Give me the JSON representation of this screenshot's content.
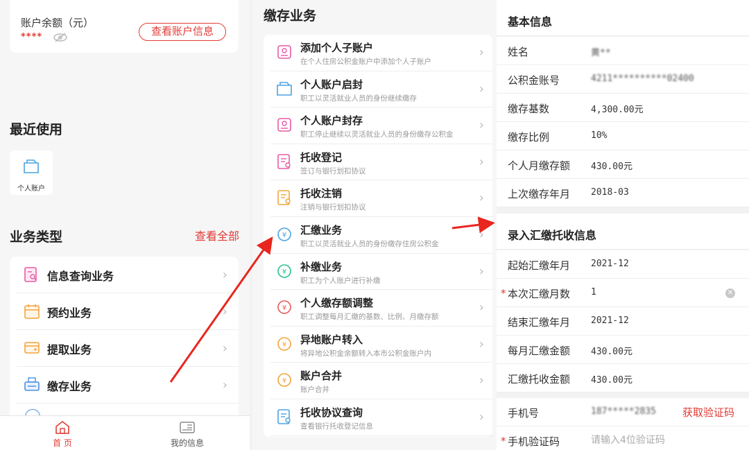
{
  "home": {
    "balance_label": "账户余额（元）",
    "balance_masked": "****",
    "view_account_btn": "查看账户信息",
    "recent_title": "最近使用",
    "recent_item": "个人账户",
    "biz_title": "业务类型",
    "view_all": "查看全部",
    "biz_items": [
      {
        "label": "信息查询业务",
        "icon": "search-doc-icon",
        "color": "#e85aa5"
      },
      {
        "label": "预约业务",
        "icon": "calendar-icon",
        "color": "#f3a43c"
      },
      {
        "label": "提取业务",
        "icon": "wallet-icon",
        "color": "#f3a43c"
      },
      {
        "label": "缴存业务",
        "icon": "deposit-icon",
        "color": "#4a8fe2"
      }
    ],
    "tabs": [
      {
        "label": "首 页",
        "active": true
      },
      {
        "label": "我的信息",
        "active": false
      }
    ],
    "accent": "#e23b35"
  },
  "deposit": {
    "title": "缴存业务",
    "items": [
      {
        "title": "添加个人子账户",
        "sub": "在个人住房公积金账户中添加个人子账户",
        "icon": "add-user-icon",
        "color": "#e85aa5"
      },
      {
        "title": "个人账户启封",
        "sub": "职工以灵活就业人员的身份继续缴存",
        "icon": "folder-open-icon",
        "color": "#4aa3e2"
      },
      {
        "title": "个人账户封存",
        "sub": "职工停止继续以灵活就业人员的身份缴存公积金",
        "icon": "folder-user-icon",
        "color": "#e85aa5"
      },
      {
        "title": "托收登记",
        "sub": "签订与银行划扣协议",
        "icon": "edit-doc-icon",
        "color": "#e85aa5"
      },
      {
        "title": "托收注销",
        "sub": "注销与银行划扣协议",
        "icon": "doc-cancel-icon",
        "color": "#f3a43c"
      },
      {
        "title": "汇缴业务",
        "sub": "职工以灵活就业人员的身份缴存住房公积金",
        "icon": "yuan-cycle-icon",
        "color": "#4aa3e2"
      },
      {
        "title": "补缴业务",
        "sub": "职工为个人账户进行补缴",
        "icon": "yuan-refresh-icon",
        "color": "#2cc08a"
      },
      {
        "title": "个人缴存额调整",
        "sub": "职工调整每月汇缴的基数、比例、月缴存额",
        "icon": "yuan-adjust-icon",
        "color": "#e85a5a"
      },
      {
        "title": "异地账户转入",
        "sub": "将异地公积金余额转入本市公积金账户内",
        "icon": "transfer-in-icon",
        "color": "#f3a43c"
      },
      {
        "title": "账户合并",
        "sub": "账户合并",
        "icon": "merge-icon",
        "color": "#f3a43c"
      },
      {
        "title": "托收协议查询",
        "sub": "查看银行托收登记信息",
        "icon": "doc-search-icon",
        "color": "#4aa3e2"
      }
    ]
  },
  "form": {
    "basic_title": "基本信息",
    "basic_rows": [
      {
        "key": "姓名",
        "value": "黄**",
        "blur": true
      },
      {
        "key": "公积金账号",
        "value": "4211**********02400",
        "blur": true
      },
      {
        "key": "缴存基数",
        "value": "4,300.00元",
        "blur": false
      },
      {
        "key": "缴存比例",
        "value": "10%",
        "blur": false
      },
      {
        "key": "个人月缴存额",
        "value": "430.00元",
        "blur": false
      },
      {
        "key": "上次缴存年月",
        "value": "2018-03",
        "blur": false
      }
    ],
    "entry_title": "录入汇缴托收信息",
    "entry_rows": [
      {
        "key": "起始汇缴年月",
        "value": "2021-12",
        "required": false
      },
      {
        "key": "本次汇缴月数",
        "value": "1",
        "required": true
      },
      {
        "key": "结束汇缴年月",
        "value": "2021-12",
        "required": false
      },
      {
        "key": "每月汇缴金额",
        "value": "430.00元",
        "required": false
      },
      {
        "key": "汇缴托收金额",
        "value": "430.00元",
        "required": false
      }
    ],
    "phone_key": "手机号",
    "phone_value": "187*****2835",
    "get_code": "获取验证码",
    "code_key": "手机验证码",
    "code_placeholder": "请输入4位验证码",
    "required_mark": "*"
  }
}
